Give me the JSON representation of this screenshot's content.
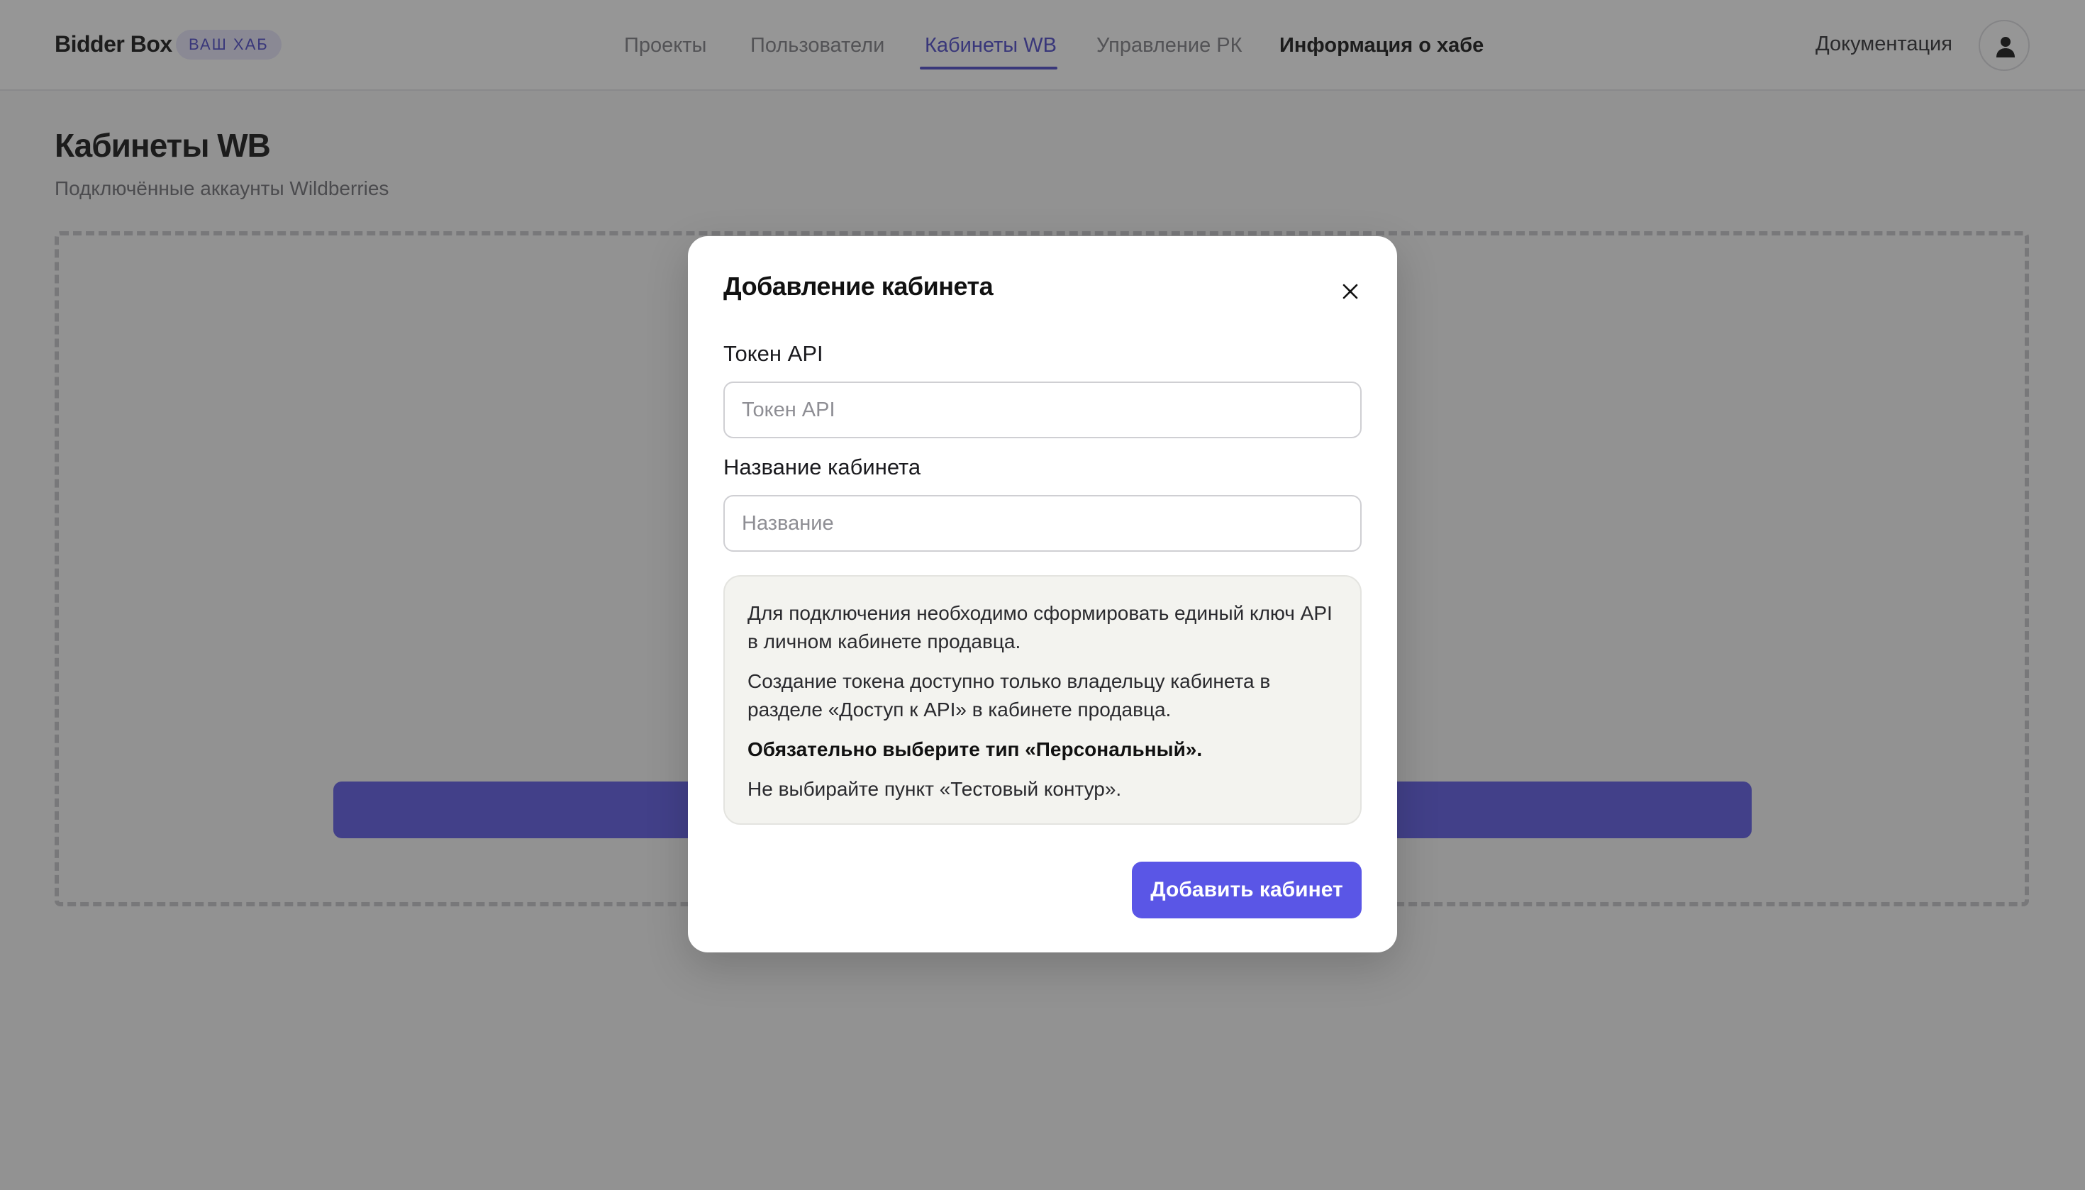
{
  "header": {
    "brand": "Bidder Box",
    "hub_badge": "ВАШ ХАБ",
    "nav": {
      "projects": "Проекты",
      "users": "Пользователи",
      "wb_cabinets": "Кабинеты WB",
      "rk_management": "Управление РК",
      "hub_info": "Информация о хабе"
    },
    "docs_link": "Документация",
    "avatar_icon": "user-icon"
  },
  "page": {
    "title": "Кабинеты WB",
    "subtitle": "Подключённые аккаунты Wildberries"
  },
  "modal": {
    "title": "Добавление кабинета",
    "close_icon": "close-icon",
    "token": {
      "label": "Токен API",
      "placeholder": "Токен API",
      "value": ""
    },
    "name": {
      "label": "Название кабинета",
      "placeholder": "Название",
      "value": ""
    },
    "info": {
      "p1": "Для подключения необходимо сформировать единый ключ API в личном кабинете продавца.",
      "p2": "Создание токена доступно только владельцу кабинета в разделе «Доступ к API» в кабинете продавца.",
      "p3": "Обязательно выберите тип «Персональный».",
      "p4": "Не выбирайте пункт «Тестовый контур»."
    },
    "submit_label": "Добавить кабинет"
  },
  "colors": {
    "accent": "#5a56e6",
    "nav_active": "#4a46c8",
    "badge_bg": "#e7e6fb",
    "overlay": "rgba(40,40,40,0.49)"
  }
}
